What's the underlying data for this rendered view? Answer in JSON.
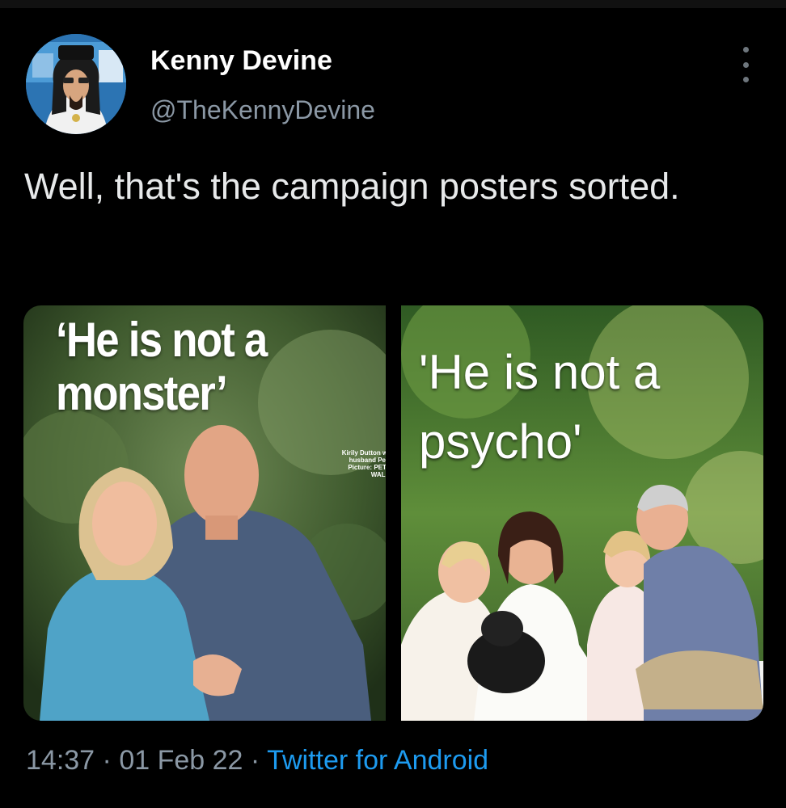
{
  "tweet": {
    "author_name": "Kenny Devine",
    "author_handle": "@TheKennyDevine",
    "text": "Well, that's the campaign posters sorted.",
    "time": "14:37",
    "separator": "·",
    "date": "01 Feb 22",
    "client": "Twitter for Android"
  },
  "media": {
    "left": {
      "headline_line1": "‘He is not a",
      "headline_line2": "monster’",
      "caption": "Kirily Dutton with husband Peter. Picture: PETER WALLIS"
    },
    "right": {
      "headline_line1": "'He is not a",
      "headline_line2": "psycho'"
    }
  },
  "colors": {
    "background": "#000000",
    "text": "#e7e9ea",
    "secondary": "#8b98a5",
    "link": "#1d9bf0"
  },
  "icons": {
    "more": "more-options-icon"
  }
}
